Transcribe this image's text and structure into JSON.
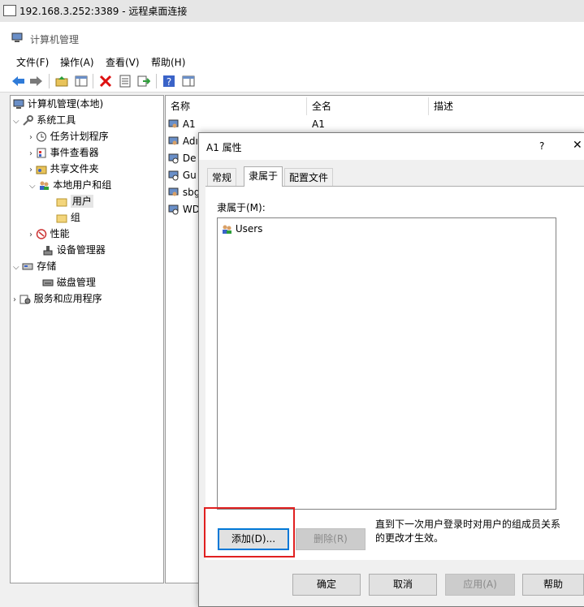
{
  "rdp": {
    "title": "192.168.3.252:3389 - 远程桌面连接"
  },
  "window": {
    "title": "计算机管理"
  },
  "menu": [
    "文件(F)",
    "操作(A)",
    "查看(V)",
    "帮助(H)"
  ],
  "toolbar_icons": [
    "back-icon",
    "forward-icon",
    "up-folder-icon",
    "show-hide-tree-icon",
    "delete-icon",
    "properties-icon",
    "export-icon",
    "help-icon",
    "show-hide-action-icon"
  ],
  "tree": [
    {
      "label": "计算机管理(本地)",
      "icon": "computer-management-icon",
      "arrow": ""
    },
    {
      "label": "系统工具",
      "icon": "tools-icon",
      "arrow": "v"
    },
    {
      "label": "任务计划程序",
      "icon": "clock-icon",
      "arrow": ">"
    },
    {
      "label": "事件查看器",
      "icon": "event-viewer-icon",
      "arrow": ">"
    },
    {
      "label": "共享文件夹",
      "icon": "shared-folder-icon",
      "arrow": ">"
    },
    {
      "label": "本地用户和组",
      "icon": "users-icon",
      "arrow": "v"
    },
    {
      "label": "用户",
      "icon": "folder-icon",
      "arrow": ""
    },
    {
      "label": "组",
      "icon": "folder-icon",
      "arrow": ""
    },
    {
      "label": "性能",
      "icon": "performance-icon",
      "arrow": ">"
    },
    {
      "label": "设备管理器",
      "icon": "device-manager-icon",
      "arrow": ""
    },
    {
      "label": "存储",
      "icon": "storage-icon",
      "arrow": "v"
    },
    {
      "label": "磁盘管理",
      "icon": "disk-icon",
      "arrow": ""
    },
    {
      "label": "服务和应用程序",
      "icon": "services-icon",
      "arrow": ">"
    }
  ],
  "list": {
    "headers": [
      "名称",
      "全名",
      "描述"
    ],
    "rows": [
      {
        "name": "A1",
        "fullname": "A1"
      },
      {
        "name": "Adı",
        "fullname": ""
      },
      {
        "name": "De",
        "fullname": ""
      },
      {
        "name": "Gu",
        "fullname": ""
      },
      {
        "name": "sbg",
        "fullname": ""
      },
      {
        "name": "WD",
        "fullname": ""
      }
    ]
  },
  "dialog": {
    "title": "A1 属性",
    "help": "?",
    "close": "✕",
    "tabs": [
      "常规",
      "隶属于",
      "配置文件"
    ],
    "member_of_label": "隶属于(M):",
    "members": [
      "Users"
    ],
    "add_button": "添加(D)...",
    "remove_button": "删除(R)",
    "note": "直到下一次用户登录时对用户的组成员关系的更改才生效。",
    "ok": "确定",
    "cancel": "取消",
    "apply": "应用(A)",
    "help_button": "帮助"
  }
}
